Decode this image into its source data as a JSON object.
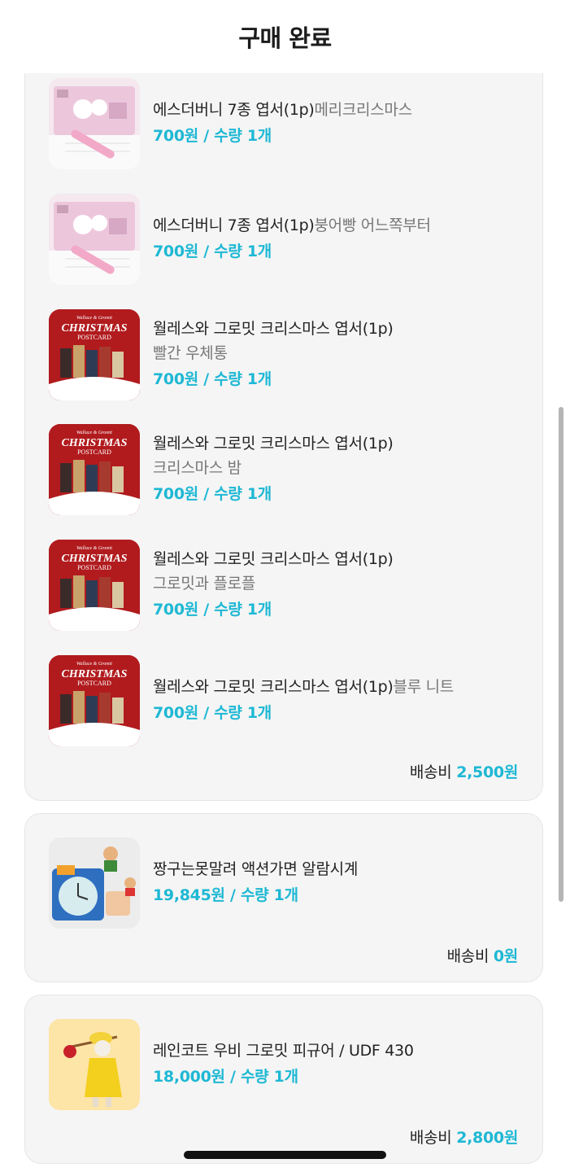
{
  "header": {
    "title": "구매 완료"
  },
  "colors": {
    "accent": "#1eb8d4",
    "card_bg": "#f5f5f5"
  },
  "orders": [
    {
      "items": [
        {
          "name": "에스더버니 7종 엽서(1p)",
          "option": "메리크리스마스",
          "price": "700원 / 수량 1개",
          "thumb_icon": "postcard-bunny-thumb"
        },
        {
          "name": "에스더버니 7종 엽서(1p)",
          "option": "붕어빵 어느쪽부터",
          "price": "700원 / 수량 1개",
          "thumb_icon": "postcard-bunny-thumb"
        },
        {
          "name": "월레스와 그로밋 크리스마스 엽서(1p)",
          "option": "빨간 우체통",
          "price": "700원 / 수량 1개",
          "thumb_icon": "christmas-postcard-thumb"
        },
        {
          "name": "월레스와 그로밋 크리스마스 엽서(1p)",
          "option": "크리스마스 밤",
          "price": "700원 / 수량 1개",
          "thumb_icon": "christmas-postcard-thumb"
        },
        {
          "name": "월레스와 그로밋 크리스마스 엽서(1p)",
          "option": "그로밋과 플로플",
          "price": "700원 / 수량 1개",
          "thumb_icon": "christmas-postcard-thumb"
        },
        {
          "name": "월레스와 그로밋 크리스마스 엽서(1p)",
          "option": "블루 니트",
          "price": "700원 / 수량 1개",
          "thumb_icon": "christmas-postcard-thumb"
        }
      ],
      "shipping_label": "배송비",
      "shipping_amount": "2,500원"
    },
    {
      "items": [
        {
          "name": "짱구는못말려 액션가면 알람시계",
          "option": "",
          "price": "19,845원 / 수량 1개",
          "thumb_icon": "alarm-clock-thumb"
        }
      ],
      "shipping_label": "배송비",
      "shipping_amount": "0원"
    },
    {
      "items": [
        {
          "name": "레인코트 우비 그로밋 피규어 / UDF 430",
          "option": "",
          "price": "18,000원 / 수량 1개",
          "thumb_icon": "gromit-figure-thumb"
        }
      ],
      "shipping_label": "배송비",
      "shipping_amount": "2,800원"
    }
  ],
  "thumb_texts": {
    "christmas": "CHRISTMAS",
    "postcard": "POSTCARD",
    "brand": "Wallace & Gromit"
  }
}
